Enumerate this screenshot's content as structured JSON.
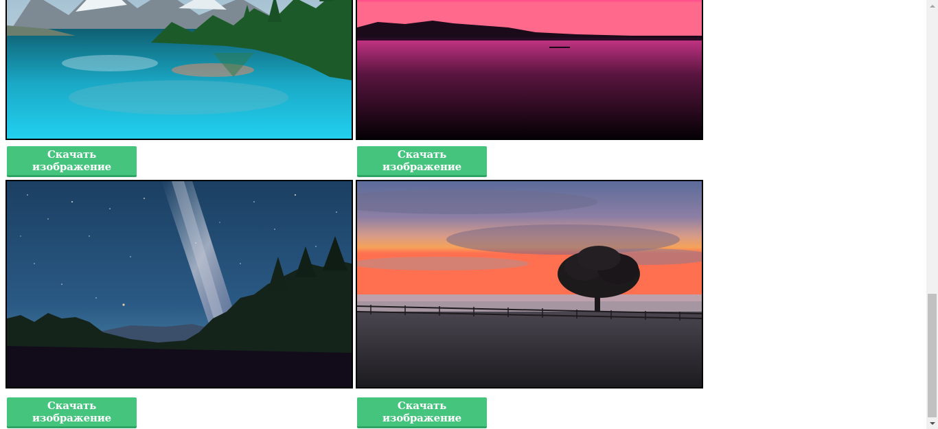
{
  "gallery": {
    "items": [
      {
        "image": "lake-mountains-reflection",
        "download_label": "Скачать изображение"
      },
      {
        "image": "pink-sunset-lake",
        "download_label": "Скачать изображение"
      },
      {
        "image": "milky-way-forest",
        "download_label": "Скачать изображение"
      },
      {
        "image": "tree-sunset-fog-field",
        "download_label": "Скачать изображение"
      }
    ]
  },
  "colors": {
    "button": "#44c47d",
    "button_shadow": "#2fa565",
    "frame_border": "#000000"
  },
  "scrollbar": {
    "thumb_position_percent": 69
  }
}
